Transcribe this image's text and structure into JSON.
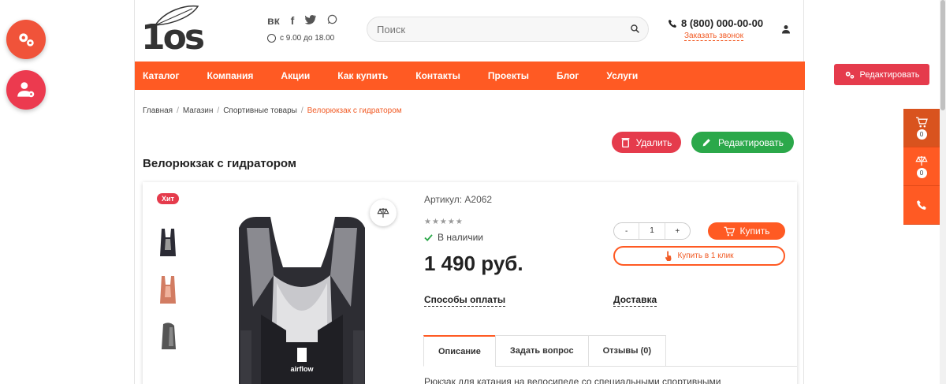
{
  "header": {
    "logo_text": "1os",
    "socials": [
      {
        "label": "vk",
        "icon": "vk-icon"
      },
      {
        "label": "f",
        "icon": "facebook-icon"
      },
      {
        "label": "t",
        "icon": "twitter-icon"
      },
      {
        "label": "w",
        "icon": "whatsapp-icon"
      }
    ],
    "hours": "с 9.00 до 18.00",
    "search_placeholder": "Поиск",
    "phone": "8 (800) 000-00-00",
    "callback": "Заказать звонок"
  },
  "nav": {
    "items": [
      "Каталог",
      "Компания",
      "Акции",
      "Как купить",
      "Контакты",
      "Проекты",
      "Блог",
      "Услуги"
    ]
  },
  "breadcrumb": {
    "items": [
      "Главная",
      "Магазин",
      "Спортивные товары"
    ],
    "current": "Велорюкзак с гидратором"
  },
  "actions": {
    "delete_label": "Удалить",
    "edit_label": "Редактировать"
  },
  "product": {
    "title": "Велорюкзак с гидратором",
    "badge": "Хит",
    "sku": "Артикул: А2062",
    "rating": 0,
    "stock": "В наличии",
    "price": "1 490 руб.",
    "qty_minus": "-",
    "qty_value": "1",
    "qty_plus": "+",
    "buy_label": "Купить",
    "oneclick_label": "Купить в 1 клик",
    "payment_label": "Способы оплаты",
    "delivery_label": "Доставка",
    "tabs": [
      "Описание",
      "Задать вопрос",
      "Отзывы (0)"
    ],
    "active_tab": 0,
    "description": "Рюкзак для катания на велосипеде со специальными спортивными",
    "brand_print": "airflow"
  },
  "admin": {
    "edit_label": "Редактировать"
  },
  "side_panel": {
    "cart_count": "0",
    "compare_count": "0"
  },
  "colors": {
    "accent": "#ff5a23",
    "danger": "#e53b4c",
    "success": "#2ba84a"
  }
}
